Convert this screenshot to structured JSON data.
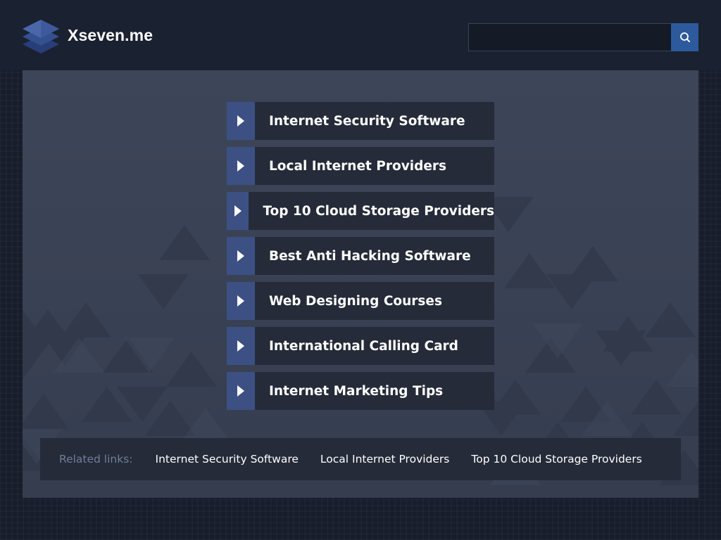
{
  "header": {
    "logo_text": "Xseven.me",
    "logo_icon": "stacked-layers-icon",
    "search": {
      "value": "",
      "placeholder": "",
      "button_icon": "search-icon"
    }
  },
  "main": {
    "links": [
      {
        "label": "Internet Security Software"
      },
      {
        "label": "Local Internet Providers"
      },
      {
        "label": "Top 10 Cloud Storage Providers"
      },
      {
        "label": "Best Anti Hacking Software"
      },
      {
        "label": "Web Designing Courses"
      },
      {
        "label": "International Calling Card"
      },
      {
        "label": "Internet Marketing Tips"
      }
    ],
    "link_icon": "play-triangle-icon"
  },
  "related": {
    "title": "Related links:",
    "links": [
      {
        "label": "Internet Security Software"
      },
      {
        "label": "Local Internet Providers"
      },
      {
        "label": "Top 10 Cloud Storage Providers"
      }
    ]
  },
  "colors": {
    "header_bg": "#1a2130",
    "main_bg": "#3d4558",
    "arrow_bg": "#3c5083",
    "label_bg": "#252b38",
    "search_btn": "#2d5a9c",
    "related_title": "#6c7f9a"
  }
}
